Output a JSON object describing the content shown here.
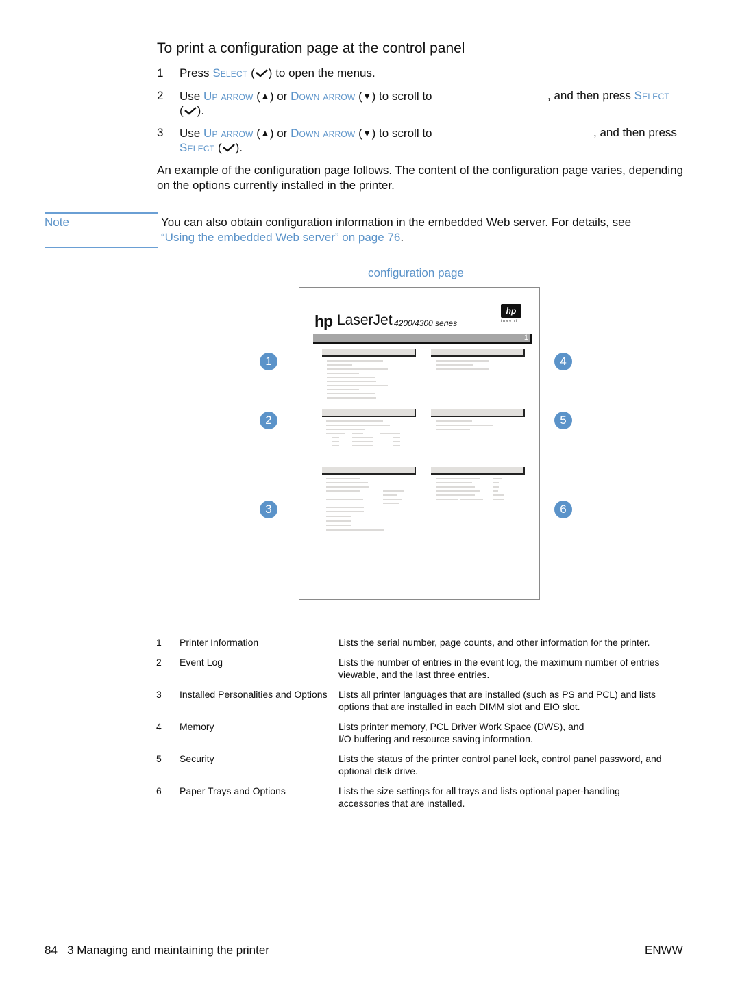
{
  "heading": "To print a configuration page at the control panel",
  "keys": {
    "select": "Select",
    "up_arrow": "Up arrow",
    "down_arrow": "Down arrow",
    "up_glyph": "▲",
    "down_glyph": "▼",
    "check_icon": "checkmark-icon"
  },
  "steps": [
    {
      "num": "1",
      "pre": "Press ",
      "post": " to open the menus."
    },
    {
      "num": "2",
      "pre": "Use ",
      "or": " or ",
      "scroll": " to scroll to",
      "tail": ", and then press "
    },
    {
      "num": "3",
      "pre": "Use ",
      "or": " or ",
      "scroll": " to scroll to",
      "tail": ", and then press"
    }
  ],
  "punct": {
    "open": " (",
    "close": ")",
    "close_period": ").",
    "period": "."
  },
  "paragraph": "An example of the configuration page follows. The content of the configuration page varies, depending on the options currently installed in the printer.",
  "note": {
    "label": "Note",
    "text": "You can also obtain configuration information in the embedded Web server. For details, see ",
    "link": "“Using the embedded Web server” on page 76",
    "end": "."
  },
  "figure": {
    "caption": "configuration page",
    "brand_hp": "hp",
    "brand_product": "LaserJet",
    "brand_series": "4200/4300 series",
    "badge": "hp",
    "invent": "invent",
    "page_number": "1",
    "callouts": [
      "1",
      "2",
      "3",
      "4",
      "5",
      "6"
    ]
  },
  "legend": [
    {
      "num": "1",
      "name": "Printer Information",
      "desc": "Lists the serial number, page counts, and other information for the printer."
    },
    {
      "num": "2",
      "name": "Event Log",
      "desc": "Lists the number of entries in the event log, the maximum number of entries viewable, and the last three entries."
    },
    {
      "num": "3",
      "name": "Installed Personalities and Options",
      "desc": "Lists all printer languages that are installed (such as PS and PCL) and lists options that are installed in each DIMM slot and EIO slot."
    },
    {
      "num": "4",
      "name": "Memory",
      "desc": "Lists printer memory, PCL Driver Work Space (DWS), and I/O buffering and resource saving information."
    },
    {
      "num": "5",
      "name": "Security",
      "desc": "Lists the status of the printer control panel lock, control panel password, and optional disk drive."
    },
    {
      "num": "6",
      "name": "Paper Trays and Options",
      "desc": "Lists the size settings for all trays and lists optional paper-handling accessories that are installed."
    }
  ],
  "footer": {
    "left": "84   3 Managing and maintaining the printer",
    "right": "ENWW"
  },
  "colors": {
    "accent": "#5b93c9",
    "rule": "#6a9fd4"
  }
}
